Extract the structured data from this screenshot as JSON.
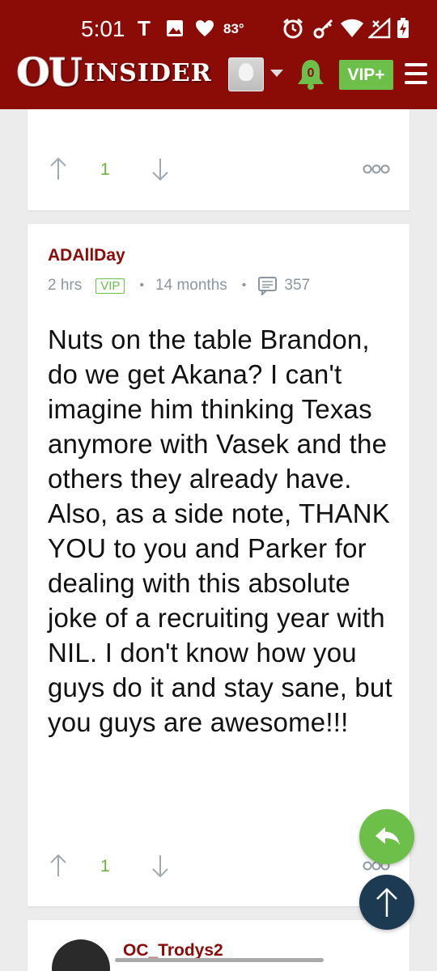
{
  "status_bar": {
    "time": "5:01",
    "carrier_icon": "T",
    "temperature": "83°",
    "icons": [
      "image-icon",
      "heart-icon",
      "alarm-icon",
      "key-icon",
      "wifi-icon",
      "signal-icon",
      "battery-icon"
    ]
  },
  "navbar": {
    "logo_ou": "OU",
    "logo_inside": "INSIDER",
    "notification_count": "0",
    "vip_label": "VIP+",
    "colors": {
      "brand": "#8b0b07",
      "accent_green": "#6cc04a"
    }
  },
  "top_card": {
    "vote_count": "1"
  },
  "comment": {
    "author": "ADAllDay",
    "posted": "2 hrs",
    "badge": "VIP",
    "membership": "14 months",
    "post_count": "357",
    "body": "Nuts on the table Brandon, do we get Akana? I can't imagine him thinking Texas anymore with Vasek and the others they already have. Also, as a side note, THANK YOU to you and Parker for dealing with this absolute joke of a recruiting year with NIL. I don't know how you guys do it and stay sane, but you guys are awesome!!!",
    "vote_count": "1"
  },
  "next_comment": {
    "author": "OC_Trodys2"
  }
}
